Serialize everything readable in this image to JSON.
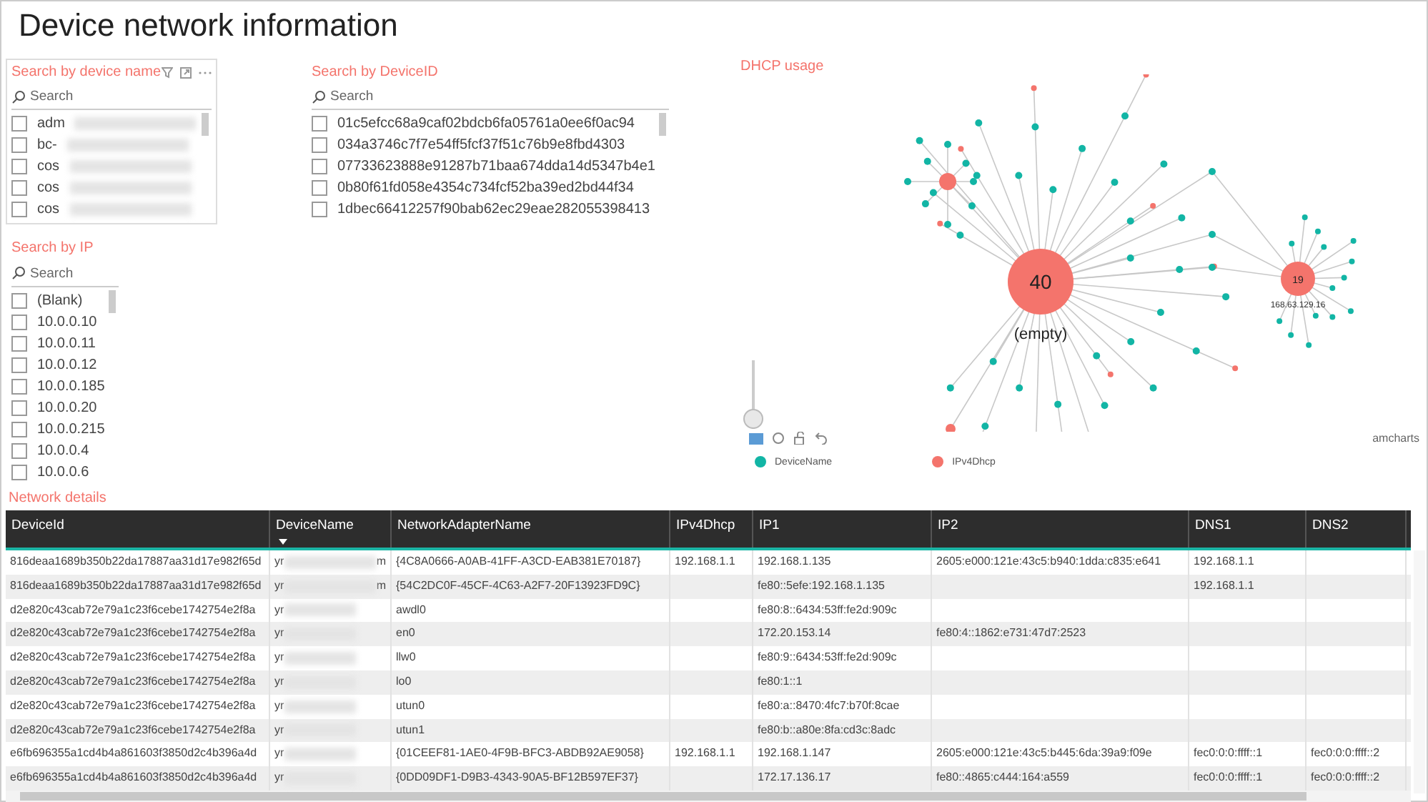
{
  "title": "Device network information",
  "slicers": [
    {
      "title": "Search by device name",
      "placeholder": "Search",
      "items": [
        {
          "label": "adm",
          "checked": false
        },
        {
          "label": "bc-",
          "checked": false
        },
        {
          "label": "cos",
          "checked": false
        },
        {
          "label": "cos",
          "checked": false
        },
        {
          "label": "cos",
          "checked": false
        }
      ]
    },
    {
      "title": "Search by DeviceID",
      "placeholder": "Search",
      "items": [
        {
          "label": "01c5efcc68a9caf02bdcb6fa05761a0ee6f0ac94",
          "checked": false
        },
        {
          "label": "034a3746c7f7e54ff5fcf37f51c76b9e8fbd4303",
          "checked": false
        },
        {
          "label": "07733623888e91287b71baa674dda14d5347b4e1",
          "checked": false
        },
        {
          "label": "0b80f61fd058e4354c734fcf52ba39ed2bd44f34",
          "checked": false
        },
        {
          "label": "1dbec66412257f90bab62ec29eae282055398413",
          "checked": false
        }
      ]
    },
    {
      "title": "Search by IP",
      "placeholder": "Search",
      "items": [
        {
          "label": "(Blank)",
          "checked": false
        },
        {
          "label": "10.0.0.10",
          "checked": false
        },
        {
          "label": "10.0.0.11",
          "checked": false
        },
        {
          "label": "10.0.0.12",
          "checked": false
        },
        {
          "label": "10.0.0.185",
          "checked": false
        },
        {
          "label": "10.0.0.20",
          "checked": false
        },
        {
          "label": "10.0.0.215",
          "checked": false
        },
        {
          "label": "10.0.0.4",
          "checked": false
        },
        {
          "label": "10.0.0.6",
          "checked": false
        }
      ]
    }
  ],
  "dhcp": {
    "title": "DHCP usage",
    "main_count": "40",
    "main_label": "(empty)",
    "second_count": "19",
    "second_label": "168.63.129.16",
    "zoom": {
      "level": 0
    },
    "credit": "amcharts",
    "legend": [
      {
        "label": "DeviceName",
        "color": "#12b5a5"
      },
      {
        "label": "IPv4Dhcp",
        "color": "#f4746c"
      }
    ]
  },
  "table": {
    "title": "Network details",
    "columns": [
      {
        "label": "DeviceId",
        "sorted": false
      },
      {
        "label": "DeviceName",
        "sorted": true
      },
      {
        "label": "NetworkAdapterName",
        "sorted": false
      },
      {
        "label": "IPv4Dhcp",
        "sorted": false
      },
      {
        "label": "IP1",
        "sorted": false
      },
      {
        "label": "IP2",
        "sorted": false
      },
      {
        "label": "DNS1",
        "sorted": false
      },
      {
        "label": "DNS2",
        "sorted": false
      }
    ],
    "rows": [
      {
        "device_id": "816deaa1689b350b22da17887aa31d17e982f65d",
        "device_name": "yr",
        "name_tail": "m",
        "adapter": "{4C8A0666-A0AB-41FF-A3CD-EAB381E70187}",
        "ipv4dhcp": "192.168.1.1",
        "ip1": "192.168.1.135",
        "ip2": "2605:e000:121e:43c5:b940:1dda:c835:e641",
        "dns1": "192.168.1.1",
        "dns2": ""
      },
      {
        "device_id": "816deaa1689b350b22da17887aa31d17e982f65d",
        "device_name": "yr",
        "name_tail": "m",
        "adapter": "{54C2DC0F-45CF-4C63-A2F7-20F13923FD9C}",
        "ipv4dhcp": "",
        "ip1": "fe80::5efe:192.168.1.135",
        "ip2": "",
        "dns1": "192.168.1.1",
        "dns2": ""
      },
      {
        "device_id": "d2e820c43cab72e79a1c23f6cebe1742754e2f8a",
        "device_name": "yr",
        "adapter": "awdl0",
        "ipv4dhcp": "",
        "ip1": "fe80:8::6434:53ff:fe2d:909c",
        "ip2": "",
        "dns1": "",
        "dns2": ""
      },
      {
        "device_id": "d2e820c43cab72e79a1c23f6cebe1742754e2f8a",
        "device_name": "yr",
        "adapter": "en0",
        "ipv4dhcp": "",
        "ip1": "172.20.153.14",
        "ip2": "fe80:4::1862:e731:47d7:2523",
        "dns1": "",
        "dns2": ""
      },
      {
        "device_id": "d2e820c43cab72e79a1c23f6cebe1742754e2f8a",
        "device_name": "yr",
        "adapter": "llw0",
        "ipv4dhcp": "",
        "ip1": "fe80:9::6434:53ff:fe2d:909c",
        "ip2": "",
        "dns1": "",
        "dns2": ""
      },
      {
        "device_id": "d2e820c43cab72e79a1c23f6cebe1742754e2f8a",
        "device_name": "yr",
        "adapter": "lo0",
        "ipv4dhcp": "",
        "ip1": "fe80:1::1",
        "ip2": "",
        "dns1": "",
        "dns2": ""
      },
      {
        "device_id": "d2e820c43cab72e79a1c23f6cebe1742754e2f8a",
        "device_name": "yr",
        "adapter": "utun0",
        "ipv4dhcp": "",
        "ip1": "fe80:a::8470:4fc7:b70f:8cae",
        "ip2": "",
        "dns1": "",
        "dns2": ""
      },
      {
        "device_id": "d2e820c43cab72e79a1c23f6cebe1742754e2f8a",
        "device_name": "yr",
        "adapter": "utun1",
        "ipv4dhcp": "",
        "ip1": "fe80:b::a80e:8fa:cd3c:8adc",
        "ip2": "",
        "dns1": "",
        "dns2": ""
      },
      {
        "device_id": "e6fb696355a1cd4b4a861603f3850d2c4b396a4d",
        "device_name": "yr",
        "adapter": "{01CEEF81-1AE0-4F9B-BFC3-ABDB92AE9058}",
        "ipv4dhcp": "192.168.1.1",
        "ip1": "192.168.1.147",
        "ip2": "2605:e000:121e:43c5:b445:6da:39a9:f09e",
        "dns1": "fec0:0:0:ffff::1",
        "dns2": "fec0:0:0:ffff::2"
      },
      {
        "device_id": "e6fb696355a1cd4b4a861603f3850d2c4b396a4d",
        "device_name": "yr",
        "adapter": "{0DD09DF1-D9B3-4343-90A5-BF12B597EF37}",
        "ipv4dhcp": "",
        "ip1": "172.17.136.17",
        "ip2": "fe80::4865:c444:164:a559",
        "dns1": "fec0:0:0:ffff::1",
        "dns2": "fec0:0:0:ffff::2"
      }
    ]
  }
}
